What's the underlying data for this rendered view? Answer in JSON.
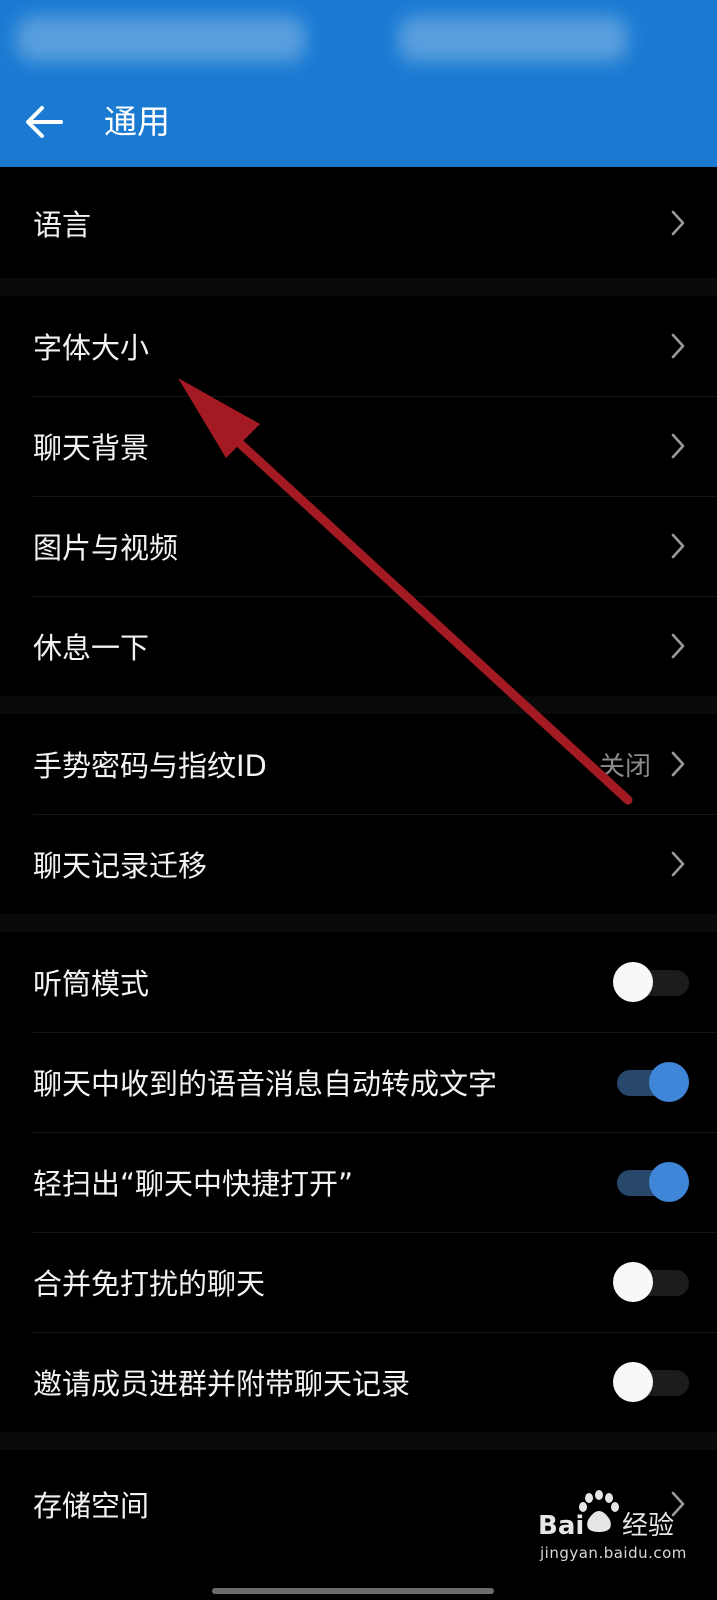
{
  "colors": {
    "header_bg": "#1a7ad2",
    "background": "#000000",
    "toggle_on": "#3f85d8",
    "toggle_on_track": "#27476b",
    "toggle_off_knob": "#f8f8f8",
    "annotation_arrow": "#a31a22"
  },
  "header": {
    "title": "通用",
    "back_icon": "arrow-left-icon"
  },
  "groups": [
    {
      "items": [
        {
          "label": "语言",
          "type": "link"
        }
      ]
    },
    {
      "items": [
        {
          "label": "字体大小",
          "type": "link"
        },
        {
          "label": "聊天背景",
          "type": "link"
        },
        {
          "label": "图片与视频",
          "type": "link"
        },
        {
          "label": "休息一下",
          "type": "link"
        }
      ]
    },
    {
      "items": [
        {
          "label": "手势密码与指纹ID",
          "type": "link",
          "value": "关闭"
        },
        {
          "label": "聊天记录迁移",
          "type": "link"
        }
      ]
    },
    {
      "items": [
        {
          "label": "听筒模式",
          "type": "toggle",
          "on": false
        },
        {
          "label": "聊天中收到的语音消息自动转成文字",
          "type": "toggle",
          "on": true
        },
        {
          "label": "轻扫出“聊天中快捷打开”",
          "type": "toggle",
          "on": true
        },
        {
          "label": "合并免打扰的聊天",
          "type": "toggle",
          "on": false
        },
        {
          "label": "邀请成员进群并附带聊天记录",
          "type": "toggle",
          "on": false
        }
      ]
    },
    {
      "items": [
        {
          "label": "存储空间",
          "type": "link"
        }
      ]
    }
  ],
  "watermark": {
    "brand": "Baidu经验",
    "url": "jingyan.baidu.com"
  }
}
